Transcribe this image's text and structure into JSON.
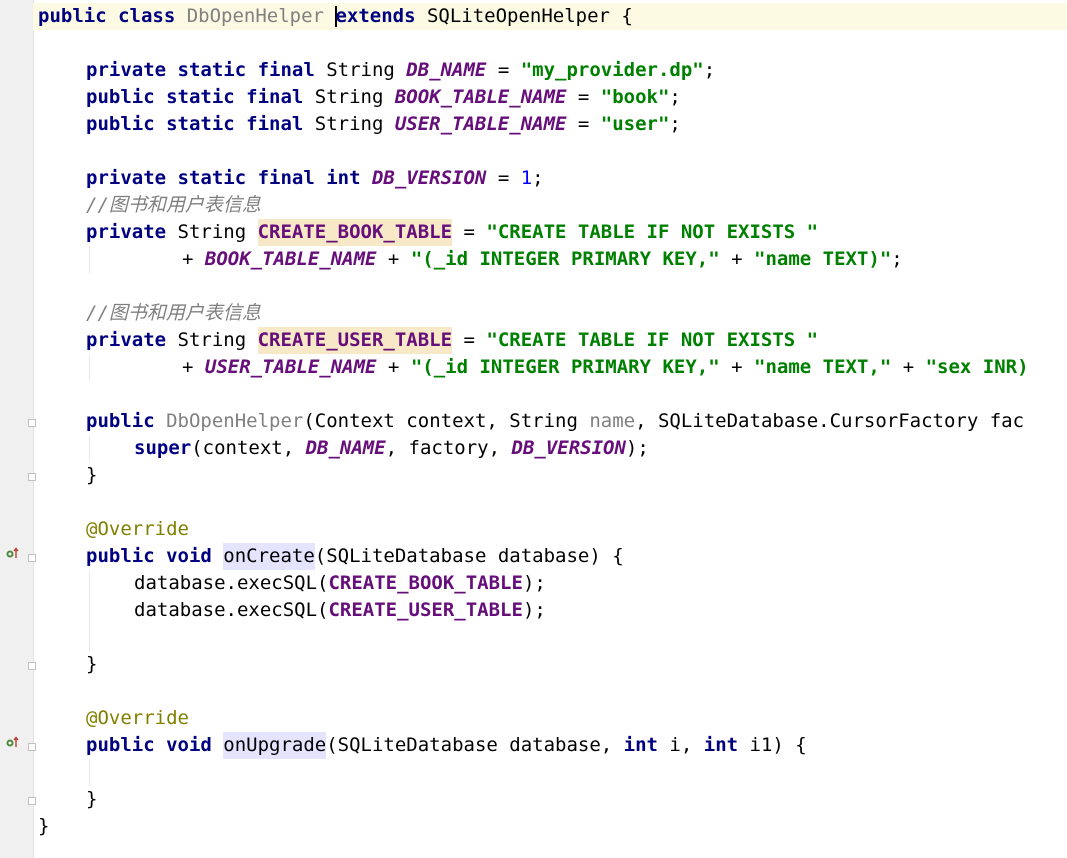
{
  "colors": {
    "keyword": "#000080",
    "constant": "#660e7a",
    "string": "#008000",
    "number": "#0000ff",
    "comment": "#808080",
    "annotation": "#808000",
    "current_line": "#fcfae3"
  },
  "icons": {
    "override": "override-gutter-icon",
    "fold": "fold-marker-icon"
  },
  "code": {
    "l1": {
      "t1": "public class ",
      "t2": "DbOpenHelper ",
      "t3": "extends",
      "t4": " SQLiteOpenHelper {"
    },
    "l3": {
      "t1": "private static final ",
      "t2": "String ",
      "t3": "DB_NAME",
      "t4": " = ",
      "t5": "\"my_provider.dp\"",
      "t6": ";"
    },
    "l4": {
      "t1": "public static final ",
      "t2": "String ",
      "t3": "BOOK_TABLE_NAME",
      "t4": " = ",
      "t5": "\"book\"",
      "t6": ";"
    },
    "l5": {
      "t1": "public static final ",
      "t2": "String ",
      "t3": "USER_TABLE_NAME",
      "t4": " = ",
      "t5": "\"user\"",
      "t6": ";"
    },
    "l7": {
      "t1": "private static final int ",
      "t2": "DB_VERSION",
      "t3": " = ",
      "t4": "1",
      "t5": ";"
    },
    "l8": {
      "t1": "//图书和用户表信息"
    },
    "l9": {
      "t1": "private ",
      "t2": "String ",
      "t3": "CREATE_BOOK_TABLE",
      "t4": " = ",
      "t5": "\"CREATE TABLE IF NOT EXISTS \""
    },
    "l10": {
      "t1": "+ ",
      "t2": "BOOK_TABLE_NAME",
      "t3": " + ",
      "t4": "\"(_id INTEGER PRIMARY KEY,\"",
      "t5": " + ",
      "t6": "\"name TEXT)\"",
      "t7": ";"
    },
    "l12": {
      "t1": "//图书和用户表信息"
    },
    "l13": {
      "t1": "private ",
      "t2": "String ",
      "t3": "CREATE_USER_TABLE",
      "t4": " = ",
      "t5": "\"CREATE TABLE IF NOT EXISTS \""
    },
    "l14": {
      "t1": "+ ",
      "t2": "USER_TABLE_NAME",
      "t3": " + ",
      "t4": "\"(_id INTEGER PRIMARY KEY,\"",
      "t5": " + ",
      "t6": "\"name TEXT,\"",
      "t7": " + ",
      "t8": "\"sex INR)"
    },
    "l16": {
      "t1": "public ",
      "t2": "DbOpenHelper",
      "t3": "(Context context, String ",
      "t4": "name",
      "t5": ", SQLiteDatabase.CursorFactory fac"
    },
    "l17": {
      "t1": "super",
      "t2": "(context, ",
      "t3": "DB_NAME",
      "t4": ", factory, ",
      "t5": "DB_VERSION",
      "t6": ");"
    },
    "l18": {
      "t1": "}"
    },
    "l20": {
      "t1": "@Override"
    },
    "l21": {
      "t1": "public void ",
      "t2": "onCreate",
      "t3": "(SQLiteDatabase database) {"
    },
    "l22": {
      "t1": "database.execSQL(",
      "t2": "CREATE_BOOK_TABLE",
      "t3": ");"
    },
    "l23": {
      "t1": "database.execSQL(",
      "t2": "CREATE_USER_TABLE",
      "t3": ");"
    },
    "l25": {
      "t1": "}"
    },
    "l27": {
      "t1": "@Override"
    },
    "l28": {
      "t1": "public void ",
      "t2": "onUpgrade",
      "t3": "(SQLiteDatabase database, ",
      "t4": "int ",
      "t5": "i, ",
      "t6": "int ",
      "t7": "i1) {"
    },
    "l30": {
      "t1": "}"
    },
    "l31": {
      "t1": "}"
    }
  }
}
